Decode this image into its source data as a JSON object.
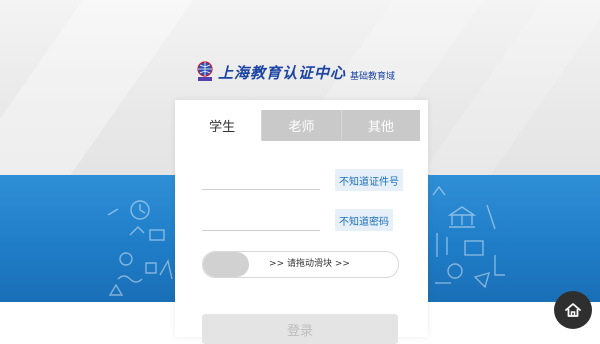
{
  "brand": {
    "name": "上海教育认证中心",
    "subtitle": "基础教育域",
    "color": "#1c44a3"
  },
  "tabs": [
    {
      "label": "学生",
      "active": true
    },
    {
      "label": "老师",
      "active": false
    },
    {
      "label": "其他",
      "active": false
    }
  ],
  "form": {
    "id_field": {
      "value": "",
      "placeholder": ""
    },
    "id_help_label": "不知道证件号",
    "password_field": {
      "value": "",
      "placeholder": ""
    },
    "password_help_label": "不知道密码",
    "slider_label": ">> 请拖动滑块 >>",
    "login_label": "登录"
  },
  "colors": {
    "band": "#1f7dc8",
    "link": "#1b6fb8",
    "tab_inactive": "#c9c9c9"
  },
  "icons": {
    "brand_logo": "globe-icon",
    "home": "home-icon"
  }
}
